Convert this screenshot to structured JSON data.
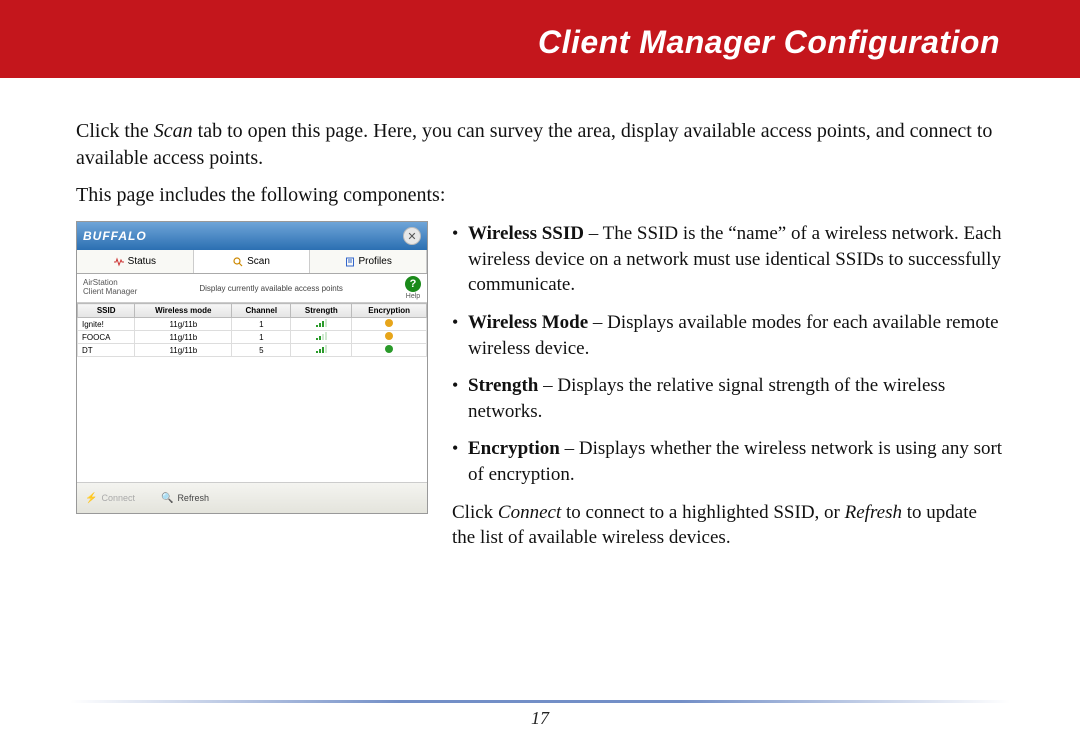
{
  "header": {
    "title": "Client Manager Configuration"
  },
  "intro": {
    "p1a": "Click the ",
    "scan_word": "Scan",
    "p1b": " tab to open this page. Here, you can survey the area, display available access points, and connect to available access points.",
    "p2": "This page includes the following components:"
  },
  "screenshot": {
    "brand": "BUFFALO",
    "close_glyph": "✕",
    "tabs": {
      "status": "Status",
      "scan": "Scan",
      "profiles": "Profiles"
    },
    "sub_left_1": "AirStation",
    "sub_left_2": "Client Manager",
    "sub_caption": "Display currently available access points",
    "help_label": "Help",
    "help_glyph": "?",
    "columns": {
      "ssid": "SSID",
      "mode": "Wireless mode",
      "channel": "Channel",
      "strength": "Strength",
      "encryption": "Encryption"
    },
    "rows": [
      {
        "ssid": "Ignite!",
        "mode": "11g/11b",
        "channel": "1",
        "strength": 3,
        "enc": "#e7a51a"
      },
      {
        "ssid": "FOOCA",
        "mode": "11g/11b",
        "channel": "1",
        "strength": 2,
        "enc": "#e7a51a"
      },
      {
        "ssid": "DT",
        "mode": "11g/11b",
        "channel": "5",
        "strength": 3,
        "enc": "#2a9a2a"
      }
    ],
    "connect_label": "Connect",
    "refresh_label": "Refresh"
  },
  "bullets": {
    "items": [
      {
        "term": "Wireless SSID",
        "desc": " – The SSID is the “name” of a wireless network. Each wireless device on a network must use identical SSIDs to successfully communicate."
      },
      {
        "term": "Wireless Mode",
        "desc": " – Displays available modes for each available remote wireless device."
      },
      {
        "term": "Strength",
        "desc": " – Displays the relative signal strength of the wireless networks."
      },
      {
        "term": "Encryption",
        "desc": " – Displays whether the wireless network is using any sort of encryption."
      }
    ],
    "tail_a": "Click ",
    "tail_connect": "Connect",
    "tail_b": " to connect to a highlighted SSID, or ",
    "tail_refresh": "Refresh",
    "tail_c": " to update the list of available wireless devices."
  },
  "page_number": "17"
}
